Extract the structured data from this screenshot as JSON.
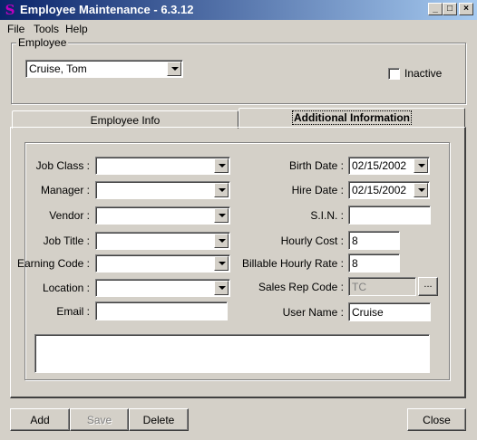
{
  "window": {
    "title": "Employee Maintenance - 6.3.12",
    "minimize": "_",
    "maximize": "□",
    "close": "×"
  },
  "menu": [
    "File",
    "Tools",
    "Help"
  ],
  "employee_group": {
    "label": "Employee",
    "selected_employee": "Cruise, Tom",
    "inactive_label": "Inactive",
    "inactive_checked": false
  },
  "tabs": {
    "employee_info": "Employee Info",
    "additional_info": "Additional Information",
    "active": "Additional Information"
  },
  "left_fields": {
    "job_class": {
      "label": "Job Class :",
      "value": ""
    },
    "manager": {
      "label": "Manager :",
      "value": ""
    },
    "vendor": {
      "label": "Vendor :",
      "value": ""
    },
    "job_title": {
      "label": "Job Title :",
      "value": ""
    },
    "earning_code": {
      "label": "Earning Code :",
      "value": ""
    },
    "location": {
      "label": "Location :",
      "value": ""
    },
    "email": {
      "label": "Email :",
      "value": ""
    }
  },
  "right_fields": {
    "birth_date": {
      "label": "Birth Date :",
      "value": "02/15/2002"
    },
    "hire_date": {
      "label": "Hire Date :",
      "value": "02/15/2002"
    },
    "sin": {
      "label": "S.I.N. :",
      "value": ""
    },
    "hourly_cost": {
      "label": "Hourly Cost :",
      "value": "8"
    },
    "billable_rate": {
      "label": "Billable Hourly Rate :",
      "value": "8"
    },
    "sales_rep_code": {
      "label": "Sales Rep Code :",
      "value": "TC"
    },
    "user_name": {
      "label": "User Name :",
      "value": "Cruise"
    }
  },
  "lookup_button": "...",
  "notes": "",
  "buttons": {
    "add": "Add",
    "save": "Save",
    "delete": "Delete",
    "close": "Close"
  }
}
